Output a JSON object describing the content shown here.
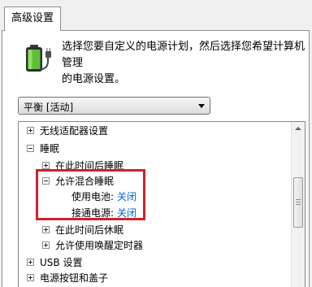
{
  "tabs": {
    "advanced": "高级设置"
  },
  "header": {
    "battery_icon": "battery-power-icon",
    "description_line1": "选择您要自定义的电源计划，然后选择您希望计算机管理",
    "description_line2": "的电源设置。"
  },
  "plan_select": {
    "value": "平衡 [活动]"
  },
  "tree": {
    "items": [
      {
        "label": "无线适配器设置",
        "expanded": false
      },
      {
        "label": "睡眠",
        "expanded": true
      },
      {
        "label": "在此时间后睡眠",
        "expanded": false
      },
      {
        "label": "允许混合睡眠",
        "expanded": true
      },
      {
        "label": "使用电池:",
        "value": "关闭"
      },
      {
        "label": "接通电源:",
        "value": "关闭"
      },
      {
        "label": "在此时间后休眠",
        "expanded": false
      },
      {
        "label": "允许使用唤醒定时器",
        "expanded": false
      },
      {
        "label": "USB 设置",
        "expanded": false
      },
      {
        "label": "电源按钮和盖子",
        "expanded": false
      }
    ]
  },
  "colors": {
    "highlight": "#d0202c",
    "link": "#0066cc"
  }
}
